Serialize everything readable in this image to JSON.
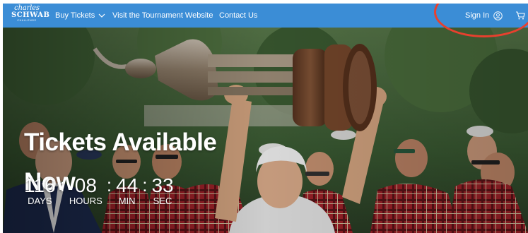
{
  "brand": {
    "logo_line1": "charles",
    "logo_line2": "SCHWAB",
    "logo_line3": "CHALLENGE"
  },
  "nav": {
    "buy_tickets": "Buy Tickets",
    "visit_site": "Visit the Tournament Website",
    "contact": "Contact Us",
    "sign_in": "Sign In"
  },
  "hero": {
    "headline_line1": "Tickets Available",
    "headline_line2": "Now"
  },
  "countdown": {
    "days": "116",
    "hours": "08",
    "min": "44",
    "sec": "33",
    "separator": ":",
    "days_label": "DAYS",
    "hours_label": "HOURS",
    "min_label": "MIN",
    "sec_label": "SEC"
  },
  "colors": {
    "nav_bg": "#3b8dd6",
    "annotation_circle": "#e8402e",
    "tartan_red": "#b2272e",
    "hero_text": "#ffffff"
  }
}
